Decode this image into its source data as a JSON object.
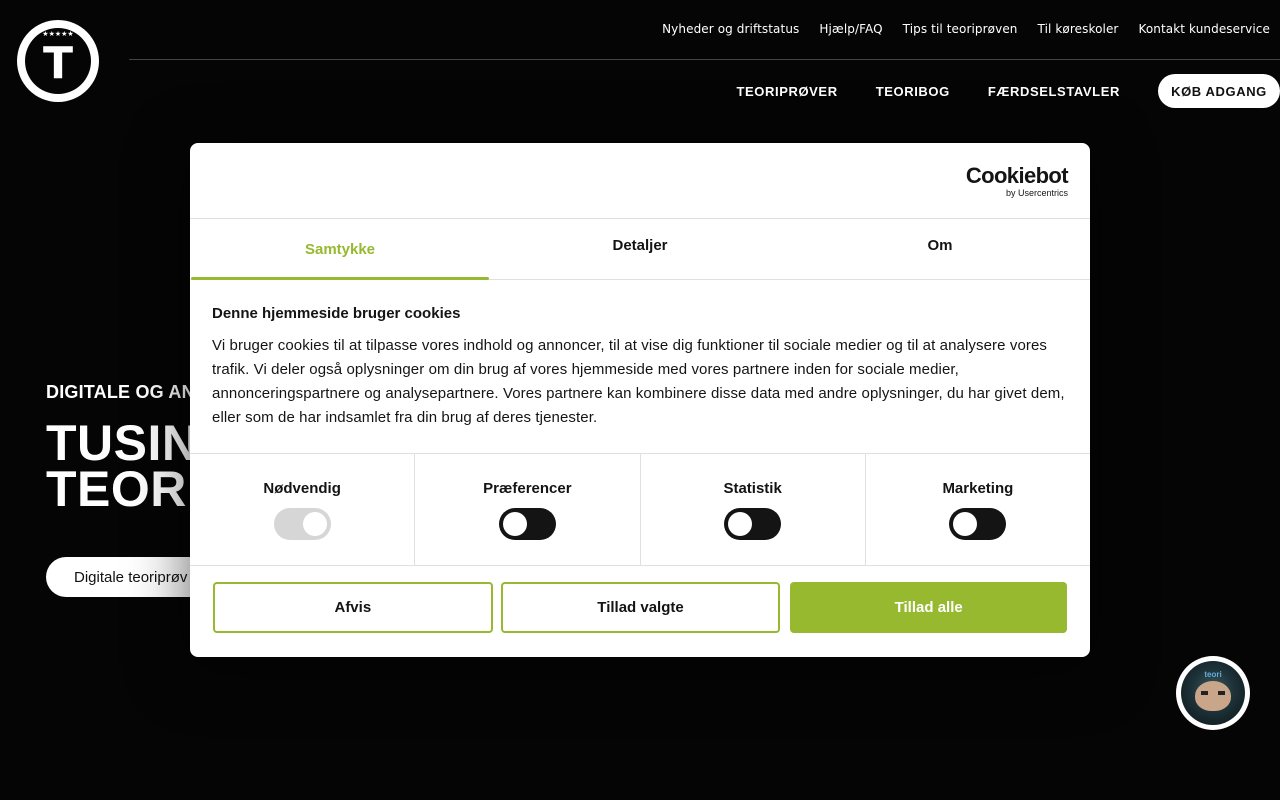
{
  "header": {
    "logo_letter": "T",
    "logo_stars": "★★★★★",
    "top_links": [
      "Nyheder og driftstatus",
      "Hjælp/FAQ",
      "Tips til teoriprøven",
      "Til køreskoler",
      "Kontakt kundeservice"
    ],
    "main_links": [
      "TEORIPRØVER",
      "TEORIBOG",
      "FÆRDSELSTAVLER"
    ],
    "buy_label": "KØB ADGANG"
  },
  "hero": {
    "subtitle": "DIGITALE OG ANA",
    "title_line1": "TUSINI",
    "title_line2": "TEORII",
    "button_label": "Digitale teoriprøv"
  },
  "cookie_dialog": {
    "brand": "Cookiebot",
    "brand_sub": "by Usercentrics",
    "tabs": [
      "Samtykke",
      "Detaljer",
      "Om"
    ],
    "heading": "Denne hjemmeside bruger cookies",
    "text": "Vi bruger cookies til at tilpasse vores indhold og annoncer, til at vise dig funktioner til sociale medier og til at analysere vores trafik. Vi deler også oplysninger om din brug af vores hjemmeside med vores partnere inden for sociale medier, annonceringspartnere og analysepartnere. Vores partnere kan kombinere disse data med andre oplysninger, du har givet dem, eller som de har indsamlet fra din brug af deres tjenester.",
    "categories": [
      {
        "label": "Nødvendig",
        "enabled": true,
        "locked": true
      },
      {
        "label": "Præferencer",
        "enabled": false
      },
      {
        "label": "Statistik",
        "enabled": false
      },
      {
        "label": "Marketing",
        "enabled": false
      }
    ],
    "buttons": {
      "deny": "Afvis",
      "allow_selected": "Tillad valgte",
      "allow_all": "Tillad alle"
    },
    "accent_color": "#97b92f"
  },
  "chat": {
    "avatar_text": "teori"
  }
}
